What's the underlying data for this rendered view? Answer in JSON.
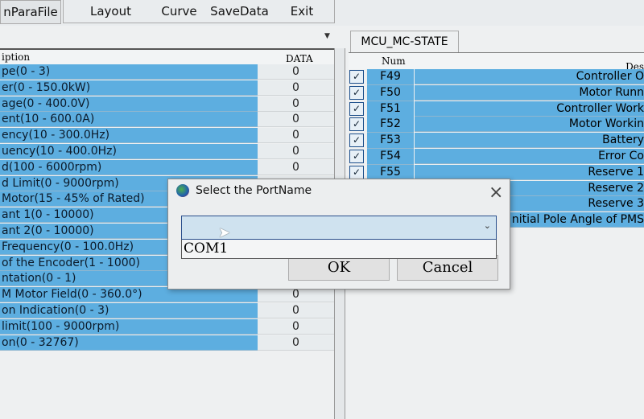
{
  "menu": {
    "items": [
      "nParaFile",
      "Layout",
      "Curve",
      "SaveData",
      "Exit"
    ]
  },
  "left_table": {
    "headers": [
      "iption",
      "DATA"
    ],
    "rows": [
      {
        "desc": "pe(0 - 3)",
        "data": "0"
      },
      {
        "desc": "er(0 - 150.0kW)",
        "data": "0"
      },
      {
        "desc": "age(0 - 400.0V)",
        "data": "0"
      },
      {
        "desc": "ent(10 - 600.0A)",
        "data": "0"
      },
      {
        "desc": "ency(10 - 300.0Hz)",
        "data": "0"
      },
      {
        "desc": "uency(10 - 400.0Hz)",
        "data": "0"
      },
      {
        "desc": "d(100 - 6000rpm)",
        "data": "0"
      },
      {
        "desc": "d Limit(0 - 9000rpm)",
        "data": ""
      },
      {
        "desc": "Motor(15 - 45% of Rated)",
        "data": ""
      },
      {
        "desc": "ant 1(0 - 10000)",
        "data": ""
      },
      {
        "desc": "ant 2(0 - 10000)",
        "data": ""
      },
      {
        "desc": " Frequency(0 - 100.0Hz)",
        "data": ""
      },
      {
        "desc": " of the Encoder(1 - 1000)",
        "data": ""
      },
      {
        "desc": "ntation(0 - 1)",
        "data": ""
      },
      {
        "desc": "M Motor Field(0 - 360.0°)",
        "data": "0"
      },
      {
        "desc": "on Indication(0 - 3)",
        "data": "0"
      },
      {
        "desc": " limit(100 - 9000rpm)",
        "data": "0"
      },
      {
        "desc": "on(0 - 32767)",
        "data": "0"
      }
    ]
  },
  "right_panel": {
    "tab": "MCU_MC-STATE",
    "headers": [
      "Num",
      "Des"
    ],
    "rows": [
      {
        "checked": true,
        "num": "F49",
        "desc": "Controller O"
      },
      {
        "checked": true,
        "num": "F50",
        "desc": "Motor Runn"
      },
      {
        "checked": true,
        "num": "F51",
        "desc": "Controller Work"
      },
      {
        "checked": true,
        "num": "F52",
        "desc": "Motor Workin"
      },
      {
        "checked": true,
        "num": "F53",
        "desc": "Battery"
      },
      {
        "checked": true,
        "num": "F54",
        "desc": "Error Co"
      },
      {
        "checked": true,
        "num": "F55",
        "desc": "Reserve 1"
      },
      {
        "checked": null,
        "num": "",
        "desc": "Reserve 2"
      },
      {
        "checked": null,
        "num": "",
        "desc": "Reserve 3"
      },
      {
        "checked": null,
        "num": "",
        "desc": "nitial Pole Angle of PMS"
      }
    ]
  },
  "dialog": {
    "title": "Select the PortName",
    "combo_value": "",
    "options": [
      "COM1"
    ],
    "ok": "OK",
    "cancel": "Cancel",
    "close": "×"
  }
}
